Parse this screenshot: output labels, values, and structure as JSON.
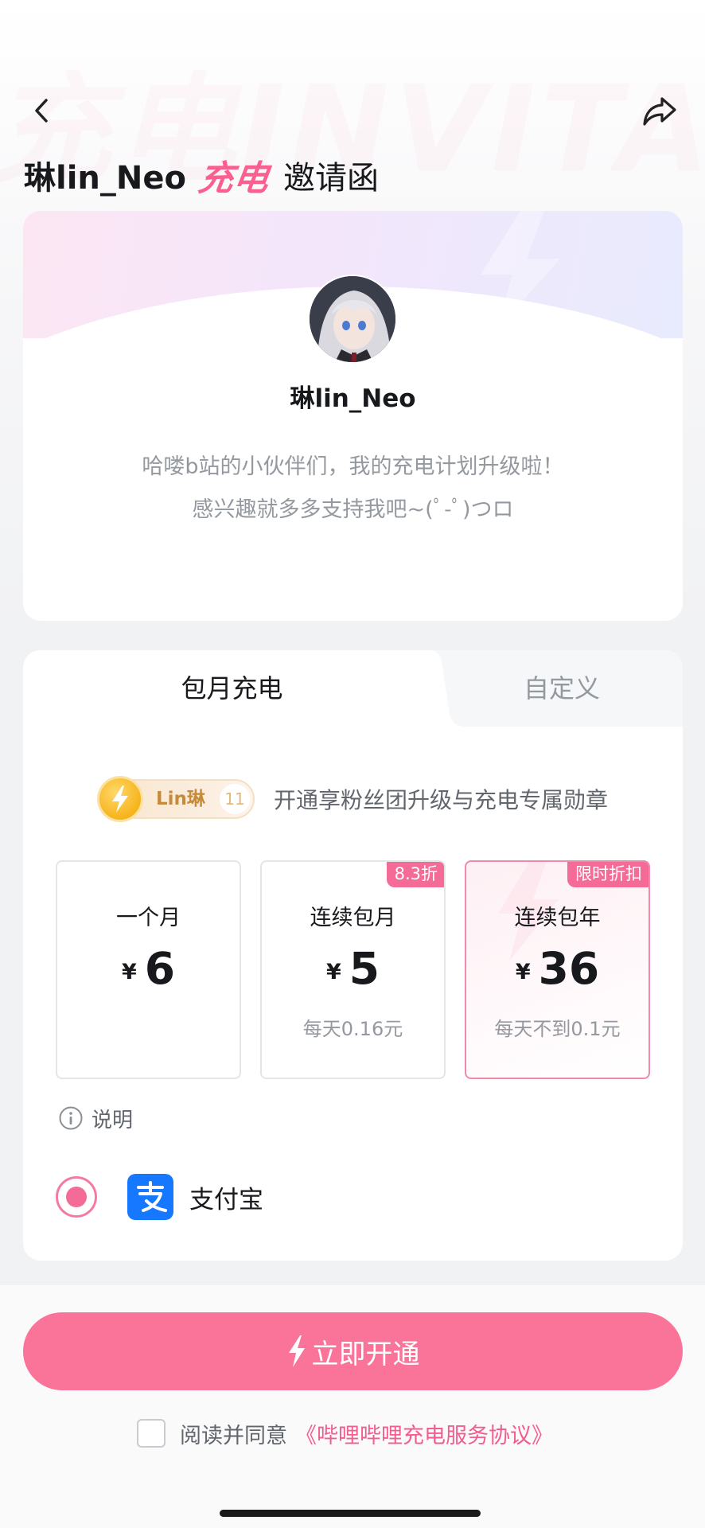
{
  "header": {
    "creator_name": "琳lin_Neo",
    "charge_word": "充电",
    "title_suffix": "邀请函",
    "back_icon": "chevron-left-icon",
    "share_icon": "share-arrow-icon"
  },
  "profile": {
    "name": "琳lin_Neo",
    "description_line1": "哈喽b站的小伙伴们，我的充电计划升级啦！",
    "description_line2": "感兴趣就多多支持我吧~(ﾟ-ﾟ)つロ"
  },
  "tabs": [
    {
      "label": "包月充电",
      "active": true
    },
    {
      "label": "自定义",
      "active": false
    }
  ],
  "benefit": {
    "medal_name": "Lin琳",
    "medal_level": "11",
    "text": "开通享粉丝团升级与充电专属勋章"
  },
  "options": [
    {
      "title": "一个月",
      "currency": "¥",
      "price": "6",
      "sub": "",
      "tag": "",
      "selected": false
    },
    {
      "title": "连续包月",
      "currency": "¥",
      "price": "5",
      "sub": "每天0.16元",
      "tag": "8.3折",
      "selected": false
    },
    {
      "title": "连续包年",
      "currency": "¥",
      "price": "36",
      "sub": "每天不到0.1元",
      "tag": "限时折扣",
      "selected": true
    }
  ],
  "explain": {
    "label": "说明",
    "icon": "info-icon"
  },
  "payment": {
    "method": "支付宝",
    "icon": "alipay-icon",
    "selected": true
  },
  "cta": {
    "label": "立即开通",
    "icon": "lightning-icon"
  },
  "agreement": {
    "prefix": "阅读并同意",
    "link": "《哔哩哔哩充电服务协议》",
    "checked": false
  },
  "colors": {
    "accent": "#fa7399",
    "tag": "#f56b97",
    "link": "#f25d8e",
    "alipay": "#1677ff"
  }
}
